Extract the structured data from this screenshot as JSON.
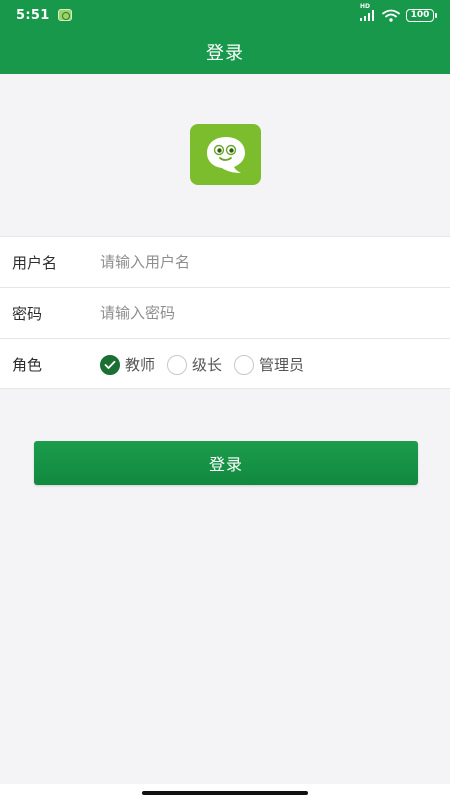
{
  "status_bar": {
    "time": "5:51",
    "network_label": "HD",
    "battery": "100"
  },
  "header": {
    "title": "登录"
  },
  "form": {
    "username": {
      "label": "用户名",
      "placeholder": "请输入用户名",
      "value": ""
    },
    "password": {
      "label": "密码",
      "placeholder": "请输入密码",
      "value": ""
    },
    "role": {
      "label": "角色",
      "options": [
        {
          "label": "教师",
          "checked": true
        },
        {
          "label": "级长",
          "checked": false
        },
        {
          "label": "管理员",
          "checked": false
        }
      ]
    }
  },
  "login_button": {
    "label": "登录"
  },
  "colors": {
    "brand_green": "#18984a",
    "logo_green": "#7bbd2c",
    "radio_checked": "#1b6f33",
    "background": "#f4f3f6"
  },
  "icons": {
    "status_app": "app-notification-icon",
    "signal": "signal-icon",
    "wifi": "wifi-icon",
    "battery": "battery-icon",
    "logo": "chat-bubble-face-icon",
    "check": "checkmark-icon"
  }
}
